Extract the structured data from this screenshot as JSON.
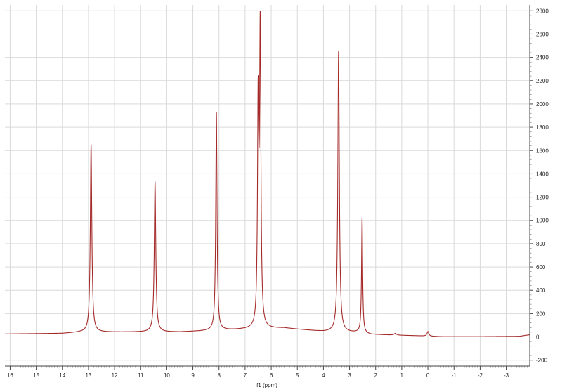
{
  "chart_data": {
    "type": "line",
    "title": "",
    "xlabel": "f1 (ppm)",
    "ylabel": "",
    "xlim": [
      16.2,
      -3.9
    ],
    "x_reversed": true,
    "ylim": [
      -250,
      2850
    ],
    "grid": true,
    "legend": "none",
    "x_ticks": [
      16,
      15,
      14,
      13,
      12,
      11,
      10,
      9,
      8,
      7,
      6,
      5,
      4,
      3,
      2,
      1,
      0,
      -1,
      -2,
      -3
    ],
    "x_tick_labels": [
      "16",
      "15",
      "14",
      "13",
      "12",
      "11",
      "10",
      "9",
      "8",
      "7",
      "6",
      "5",
      "4",
      "3",
      "2",
      "1",
      "0",
      "-1",
      "-2",
      "-3"
    ],
    "y_ticks": [
      -200,
      0,
      200,
      400,
      600,
      800,
      1000,
      1200,
      1400,
      1600,
      1800,
      2000,
      2200,
      2400,
      2600,
      2800
    ],
    "y_tick_labels": [
      "-200",
      "0",
      "200",
      "400",
      "600",
      "800",
      "1000",
      "1200",
      "1400",
      "1600",
      "1800",
      "2000",
      "2200",
      "2400",
      "2600",
      "2800"
    ],
    "series": [
      {
        "color": "#a52a2a",
        "baseline": [
          {
            "x": 16.2,
            "y": 25
          },
          {
            "x": 14.0,
            "y": 30
          },
          {
            "x": 13.3,
            "y": 40
          },
          {
            "x": 11.0,
            "y": 42
          },
          {
            "x": 9.5,
            "y": 42
          },
          {
            "x": 7.0,
            "y": 65
          },
          {
            "x": 5.5,
            "y": 75
          },
          {
            "x": 4.0,
            "y": 45
          },
          {
            "x": 2.7,
            "y": 35
          },
          {
            "x": 2.2,
            "y": 20
          },
          {
            "x": 0.5,
            "y": 10
          },
          {
            "x": -0.5,
            "y": 2
          },
          {
            "x": -2.0,
            "y": 2
          },
          {
            "x": -3.5,
            "y": 5
          },
          {
            "x": -3.9,
            "y": 18
          }
        ],
        "peaks": [
          {
            "x": 12.9,
            "height": 1610,
            "width": 0.035
          },
          {
            "x": 10.45,
            "height": 1290,
            "width": 0.035
          },
          {
            "x": 8.1,
            "height": 1870,
            "width": 0.03
          },
          {
            "x": 6.5,
            "height": 1860,
            "width": 0.03
          },
          {
            "x": 6.42,
            "height": 2500,
            "width": 0.03
          },
          {
            "x": 3.42,
            "height": 2410,
            "width": 0.035
          },
          {
            "x": 2.52,
            "height": 990,
            "width": 0.025
          },
          {
            "x": 1.25,
            "height": 15,
            "width": 0.05
          },
          {
            "x": 0.0,
            "height": 40,
            "width": 0.04
          }
        ]
      }
    ]
  }
}
